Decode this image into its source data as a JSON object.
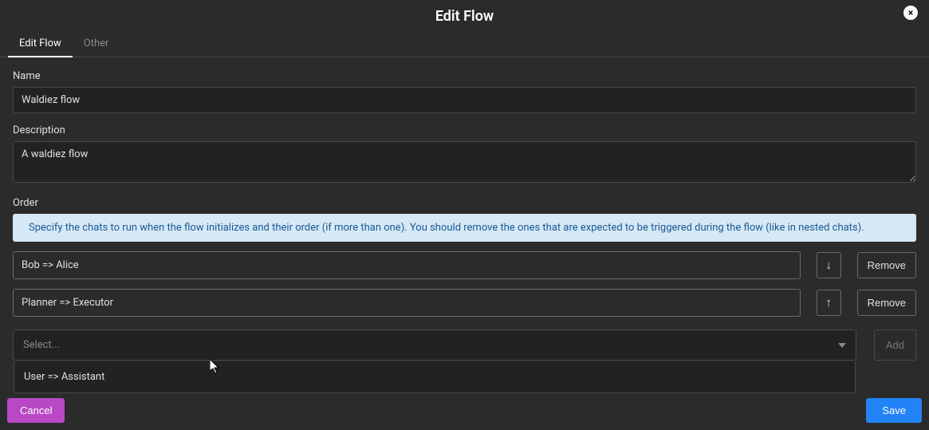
{
  "modal": {
    "title": "Edit Flow",
    "close_label": "×"
  },
  "tabs": [
    {
      "label": "Edit Flow",
      "active": true
    },
    {
      "label": "Other",
      "active": false
    }
  ],
  "fields": {
    "name_label": "Name",
    "name_value": "Waldiez flow",
    "description_label": "Description",
    "description_value": "A waldiez flow",
    "order_label": "Order",
    "order_info": "Specify the chats to run when the flow initializes and their order (if more than one). You should remove the ones that are expected to be triggered during the flow (like in nested chats)."
  },
  "order_items": [
    {
      "label": "Bob => Alice",
      "move_down": "↓",
      "remove": "Remove"
    },
    {
      "label": "Planner => Executor",
      "move_up": "↑",
      "remove": "Remove"
    }
  ],
  "select": {
    "placeholder": "Select...",
    "options": [
      {
        "label": "User => Assistant"
      }
    ],
    "add_label": "Add"
  },
  "footer": {
    "cancel": "Cancel",
    "save": "Save"
  }
}
